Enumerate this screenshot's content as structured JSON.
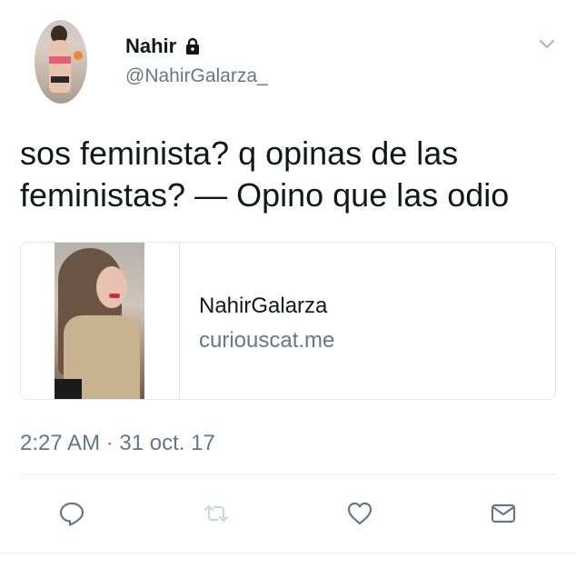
{
  "user": {
    "name": "Nahir",
    "handle": "@NahirGalarza_",
    "protected_icon": "lock-icon"
  },
  "tweet": {
    "text": "sos feminista? q opinas de las feministas? — Opino que las odio",
    "timestamp": "2:27 AM · 31 oct. 17"
  },
  "card": {
    "title": "NahirGalarza",
    "domain": "curiouscat.me"
  },
  "actions": [
    {
      "icon": "reply-icon"
    },
    {
      "icon": "retweet-icon"
    },
    {
      "icon": "like-icon"
    },
    {
      "icon": "direct-message-icon"
    }
  ],
  "colors": {
    "text": "#14171a",
    "secondary": "#657786",
    "icon": "#657786",
    "border": "#e1e8ed"
  }
}
